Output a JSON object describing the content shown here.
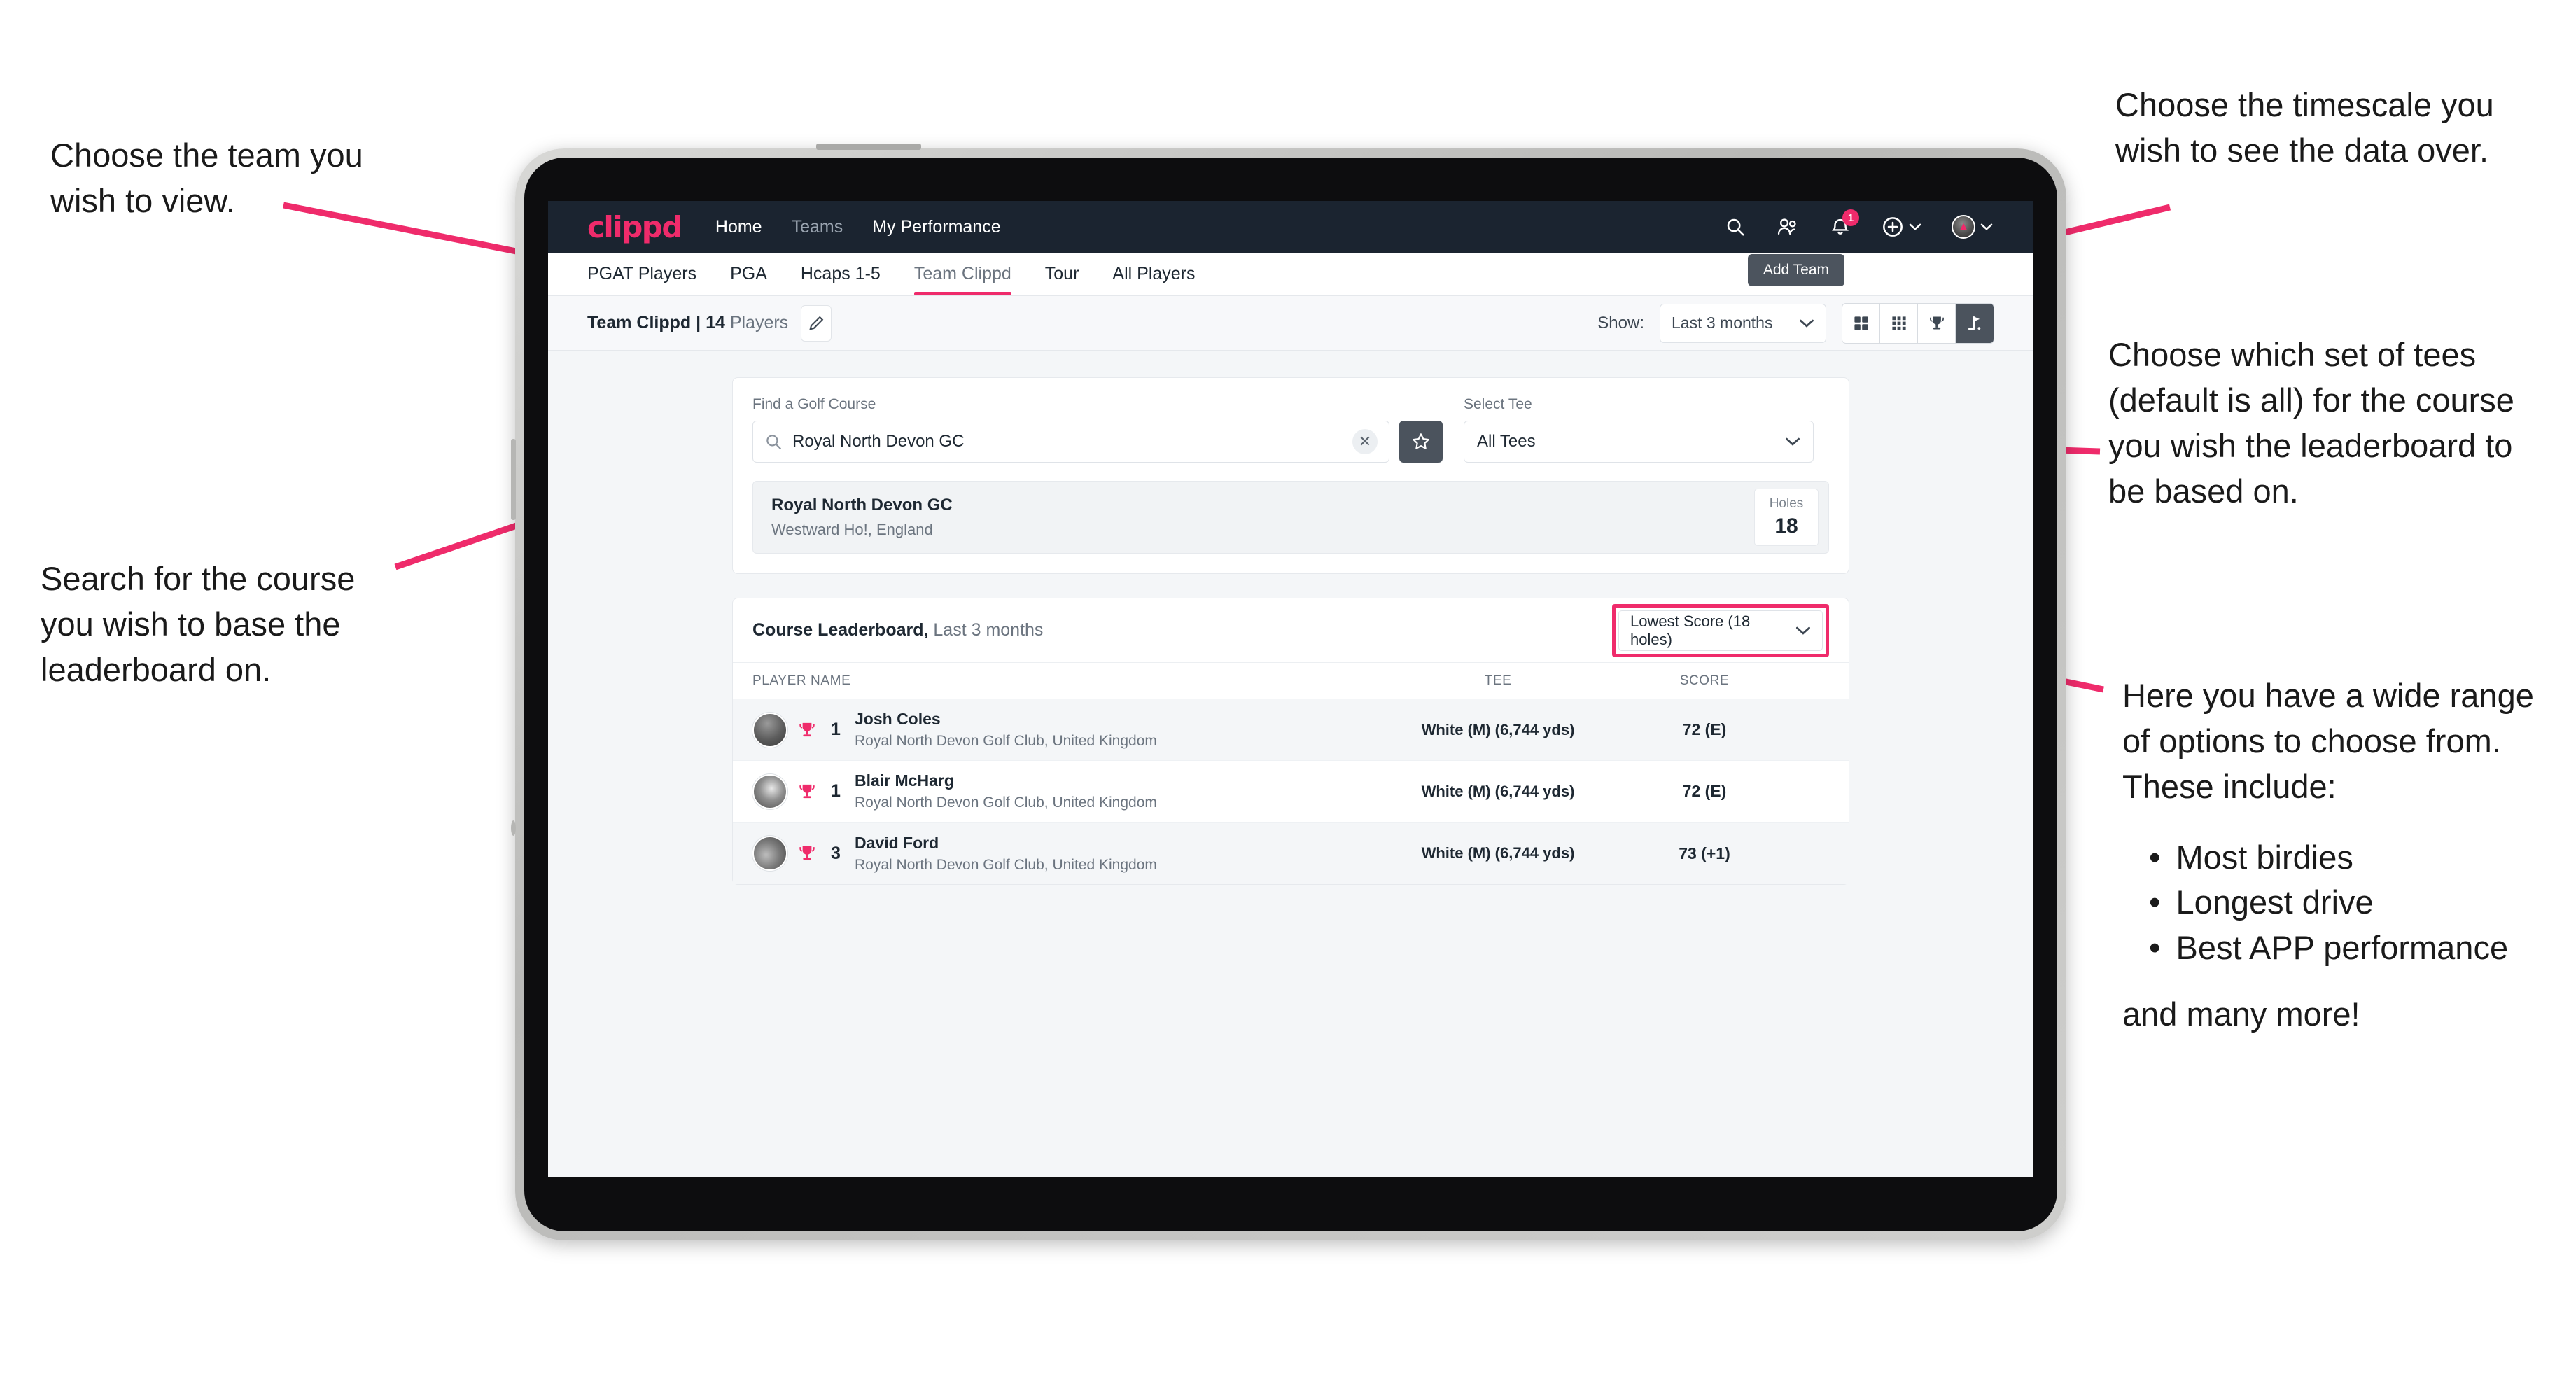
{
  "annotations": {
    "team": "Choose the team you\nwish to view.",
    "search": "Search for the course\nyou wish to base the\nleaderboard on.",
    "timescale": "Choose the timescale you\nwish to see the data over.",
    "tees": "Choose which set of tees\n(default is all) for the course\nyou wish the leaderboard to\nbe based on.",
    "options_intro": "Here you have a wide range\nof options to choose from.\nThese include:",
    "options_list": [
      "Most birdies",
      "Longest drive",
      "Best APP performance"
    ],
    "options_outro": "and many more!"
  },
  "navbar": {
    "logo": "clippd",
    "links": [
      {
        "label": "Home",
        "dim": false
      },
      {
        "label": "Teams",
        "dim": true
      },
      {
        "label": "My Performance",
        "dim": false
      }
    ],
    "icons": {
      "search": "search-icon",
      "people": "people-icon",
      "bell": "bell-icon",
      "bell_badge": "1",
      "add": "plus-circle-icon",
      "avatar": "avatar-icon"
    }
  },
  "tabs": [
    {
      "label": "PGAT Players",
      "active": false
    },
    {
      "label": "PGA",
      "active": false
    },
    {
      "label": "Hcaps 1-5",
      "active": false
    },
    {
      "label": "Team Clippd",
      "active": true
    },
    {
      "label": "Tour",
      "active": false
    },
    {
      "label": "All Players",
      "active": false
    }
  ],
  "tooltip": {
    "add_team": "Add Team"
  },
  "toolbar": {
    "team_name": "Team Clippd",
    "separator": " | ",
    "player_count": "14",
    "players_word": " Players",
    "edit_icon": "pencil-icon",
    "show_label": "Show:",
    "show_value": "Last 3 months",
    "view_toggles": [
      {
        "icon": "grid-2x2-icon",
        "active": false
      },
      {
        "icon": "grid-3x3-icon",
        "active": false
      },
      {
        "icon": "trophy-icon",
        "active": false
      },
      {
        "icon": "golf-flag-icon",
        "active": true
      }
    ]
  },
  "search_card": {
    "course_field_label": "Find a Golf Course",
    "course_value": "Royal North Devon GC",
    "clear_icon": "close-icon",
    "star_icon": "star-icon",
    "tee_field_label": "Select Tee",
    "tee_value": "All Tees"
  },
  "course_result": {
    "name": "Royal North Devon GC",
    "location": "Westward Ho!, England",
    "holes_label": "Holes",
    "holes_value": "18"
  },
  "leaderboard": {
    "title": "Course Leaderboard,",
    "subtitle": " Last 3 months",
    "sort_value": "Lowest Score (18 holes)",
    "columns": [
      "PLAYER NAME",
      "TEE",
      "SCORE"
    ],
    "rows": [
      {
        "rank": "1",
        "name": "Josh Coles",
        "club": "Royal North Devon Golf Club, United Kingdom",
        "tee": "White (M) (6,744 yds)",
        "score": "72 (E)"
      },
      {
        "rank": "1",
        "name": "Blair McHarg",
        "club": "Royal North Devon Golf Club, United Kingdom",
        "tee": "White (M) (6,744 yds)",
        "score": "72 (E)"
      },
      {
        "rank": "3",
        "name": "David Ford",
        "club": "Royal North Devon Golf Club, United Kingdom",
        "tee": "White (M) (6,744 yds)",
        "score": "73 (+1)"
      }
    ]
  },
  "colors": {
    "accent": "#ef2b6b",
    "navbar": "#1b2430",
    "dark_button": "#4b535d",
    "page_bg": "#f4f6f8"
  }
}
